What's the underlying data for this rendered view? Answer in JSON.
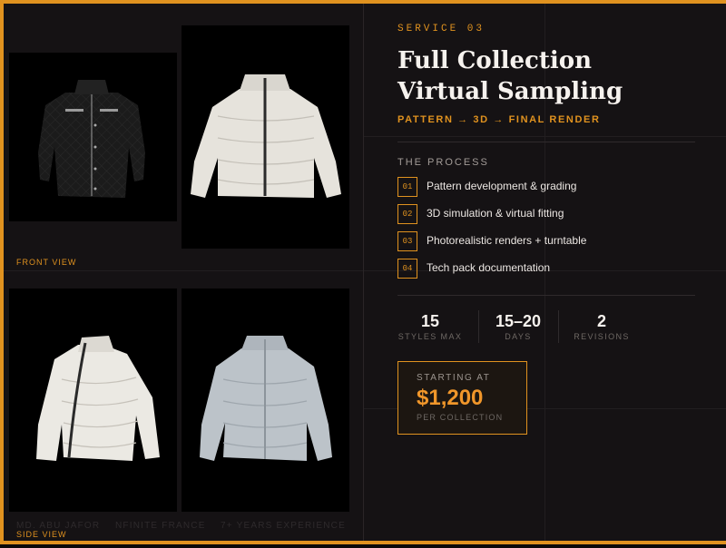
{
  "service": {
    "eyebrow": "SERVICE 03",
    "title_line1": "Full Collection",
    "title_line2": "Virtual Sampling",
    "subtitle": "PATTERN → 3D → FINAL RENDER"
  },
  "gallery": {
    "front_label": "FRONT VIEW",
    "side_label": "SIDE VIEW",
    "tiles": [
      {
        "name": "black-quilted-jacket",
        "color": "#161616"
      },
      {
        "name": "white-puffer-front",
        "color": "#e4e1da"
      },
      {
        "name": "white-puffer-side",
        "color": "#e8e6e0"
      },
      {
        "name": "pale-blue-puffer-front",
        "color": "#b9c0c6"
      }
    ]
  },
  "footer": {
    "name": "MD. ABU JAFOR",
    "brand": "NFINITE FRANCE",
    "experience": "7+ YEARS EXPERIENCE"
  },
  "process": {
    "label": "THE PROCESS",
    "steps": [
      {
        "num": "01",
        "text": "Pattern development & grading"
      },
      {
        "num": "02",
        "text": "3D simulation & virtual fitting"
      },
      {
        "num": "03",
        "text": "Photorealistic renders + turntable"
      },
      {
        "num": "04",
        "text": "Tech pack documentation"
      }
    ]
  },
  "stats": [
    {
      "value": "15",
      "label": "STYLES MAX"
    },
    {
      "value": "15–20",
      "label": "DAYS"
    },
    {
      "value": "2",
      "label": "REVISIONS"
    }
  ],
  "pricing": {
    "kicker": "STARTING AT",
    "price": "$1,200",
    "unit": "PER COLLECTION"
  },
  "colors": {
    "accent": "#e0921f",
    "background": "#151214",
    "text": "#f6f2ee"
  }
}
